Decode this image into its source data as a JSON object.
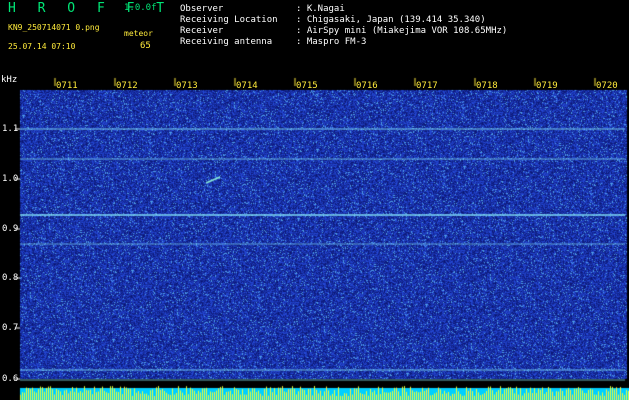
{
  "header": {
    "app_title": "H R O F F T",
    "version": "1.0.0f",
    "filename": "KN9_250714071 0.png",
    "datetime": "25.07.14 07:10",
    "meteor_label": "meteor",
    "meteor_count": "65"
  },
  "info": [
    {
      "key": "Observer",
      "value": ": K.Nagai"
    },
    {
      "key": "Receiving Location",
      "value": ": Chigasaki, Japan (139.414 35.340)"
    },
    {
      "key": "Receiver",
      "value": ": AirSpy mini (Miakejima VOR 108.65MHz)"
    },
    {
      "key": "Receiving antenna",
      "value": ": Maspro FM-3"
    }
  ],
  "axis": {
    "unit": "kHz",
    "y_ticks": [
      "1.1",
      "1.0",
      "0.9",
      "0.8",
      "0.7",
      "0.6"
    ],
    "time_ticks": [
      "0711",
      "0712",
      "0713",
      "0714",
      "0715",
      "0716",
      "0717",
      "0718",
      "0719",
      "0720"
    ]
  },
  "colors": {
    "background": "#000000",
    "field": "#0a1a8a",
    "signal": "#7fe8ff",
    "label_green": "#00e676",
    "label_yellow": "#ffeb3b",
    "meter": "#00cfff"
  }
}
